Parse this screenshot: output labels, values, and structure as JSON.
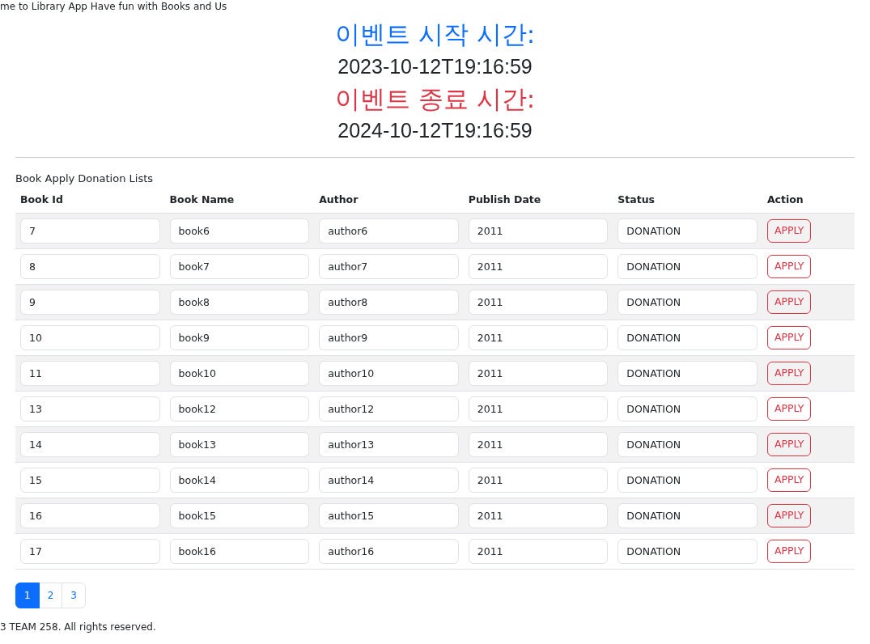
{
  "welcome_text": "me to Library App Have fun with Books and Us",
  "event": {
    "start_label": "이벤트 시작 시간:",
    "start_time": "2023-10-12T19:16:59",
    "end_label": "이벤트 종료 시간:",
    "end_time": "2024-10-12T19:16:59"
  },
  "list_title": "Book Apply Donation Lists",
  "table": {
    "columns": [
      "Book Id",
      "Book Name",
      "Author",
      "Publish Date",
      "Status",
      "Action"
    ],
    "rows": [
      {
        "book_id": "7",
        "book_name": "book6",
        "author": "author6",
        "publish_date": "2011",
        "status": "DONATION",
        "action": "APPLY"
      },
      {
        "book_id": "8",
        "book_name": "book7",
        "author": "author7",
        "publish_date": "2011",
        "status": "DONATION",
        "action": "APPLY"
      },
      {
        "book_id": "9",
        "book_name": "book8",
        "author": "author8",
        "publish_date": "2011",
        "status": "DONATION",
        "action": "APPLY"
      },
      {
        "book_id": "10",
        "book_name": "book9",
        "author": "author9",
        "publish_date": "2011",
        "status": "DONATION",
        "action": "APPLY"
      },
      {
        "book_id": "11",
        "book_name": "book10",
        "author": "author10",
        "publish_date": "2011",
        "status": "DONATION",
        "action": "APPLY"
      },
      {
        "book_id": "13",
        "book_name": "book12",
        "author": "author12",
        "publish_date": "2011",
        "status": "DONATION",
        "action": "APPLY"
      },
      {
        "book_id": "14",
        "book_name": "book13",
        "author": "author13",
        "publish_date": "2011",
        "status": "DONATION",
        "action": "APPLY"
      },
      {
        "book_id": "15",
        "book_name": "book14",
        "author": "author14",
        "publish_date": "2011",
        "status": "DONATION",
        "action": "APPLY"
      },
      {
        "book_id": "16",
        "book_name": "book15",
        "author": "author15",
        "publish_date": "2011",
        "status": "DONATION",
        "action": "APPLY"
      },
      {
        "book_id": "17",
        "book_name": "book16",
        "author": "author16",
        "publish_date": "2011",
        "status": "DONATION",
        "action": "APPLY"
      }
    ]
  },
  "pagination": [
    {
      "label": "1",
      "selected": true
    },
    {
      "label": "2",
      "selected": false
    },
    {
      "label": "3",
      "selected": false
    }
  ],
  "footer": "3 TEAM 258. All rights reserved."
}
